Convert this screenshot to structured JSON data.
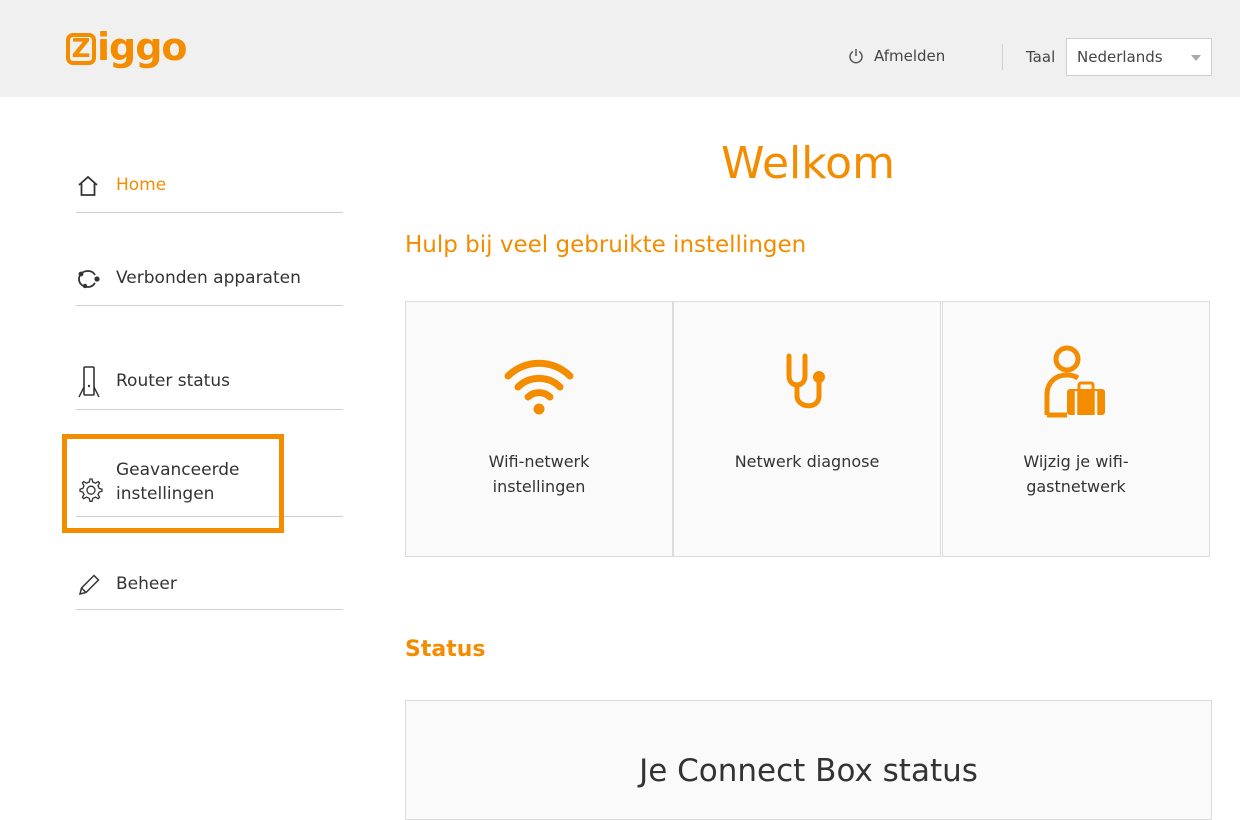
{
  "brand": {
    "logo_box_letter": "Z",
    "logo_rest": "iggo",
    "accent_color": "#f48c00"
  },
  "header": {
    "logout_label": "Afmelden",
    "language_label": "Taal",
    "language_value": "Nederlands"
  },
  "sidebar": {
    "items": [
      {
        "label": "Home",
        "icon": "home-icon",
        "active": true
      },
      {
        "label": "Verbonden apparaten",
        "icon": "connected-devices-icon"
      },
      {
        "label": "Router status",
        "icon": "router-icon"
      },
      {
        "label": "Geavanceerde instellingen",
        "icon": "gear-icon",
        "highlighted": true
      },
      {
        "label": "Beheer",
        "icon": "pencil-icon"
      }
    ]
  },
  "main": {
    "title": "Welkom",
    "help_section_title": "Hulp bij veel gebruikte instellingen",
    "cards": [
      {
        "label": "Wifi-netwerk instellingen",
        "icon": "wifi-icon"
      },
      {
        "label": "Netwerk diagnose",
        "icon": "stethoscope-icon"
      },
      {
        "label": "Wijzig je wifi-gastnetwerk",
        "icon": "guest-person-suitcase-icon"
      }
    ],
    "status_section_title": "Status",
    "status_box_title": "Je Connect Box status"
  }
}
